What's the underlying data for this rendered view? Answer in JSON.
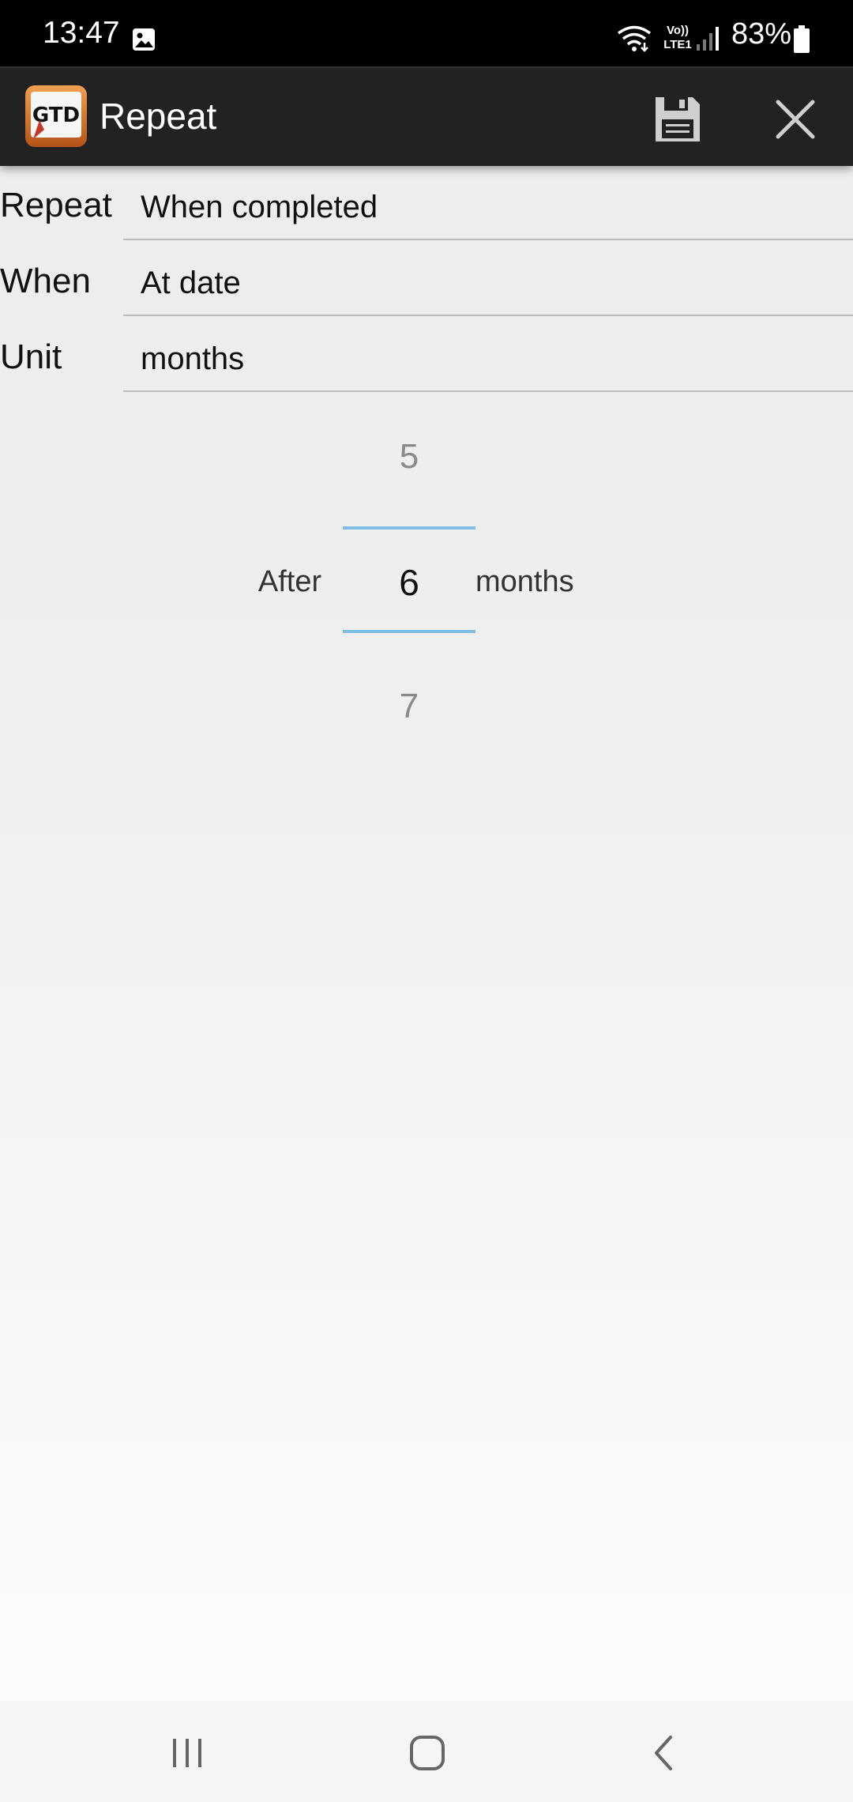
{
  "status_bar": {
    "time": "13:47",
    "volte_label_line1": "Vo))",
    "volte_label_line2": "LTE1",
    "battery_text": "83%",
    "icons": [
      "gallery-icon",
      "wifi-icon",
      "signal-icon",
      "battery-icon"
    ]
  },
  "action_bar": {
    "title": "Repeat",
    "logo_text": "GTD",
    "save_icon": "save-icon",
    "close_icon": "close-icon",
    "background": "#222222"
  },
  "form": {
    "rows": [
      {
        "label": "Repeat",
        "value": "When completed"
      },
      {
        "label": "When",
        "value": "At date"
      },
      {
        "label": "Unit",
        "value": "months"
      }
    ]
  },
  "picker": {
    "prefix": "After",
    "previous": "5",
    "current": "6",
    "next": "7",
    "suffix": "months",
    "divider_color": "#7fbfe4"
  },
  "nav_bar": {
    "icons": [
      "recents-icon",
      "home-icon",
      "back-icon"
    ]
  }
}
